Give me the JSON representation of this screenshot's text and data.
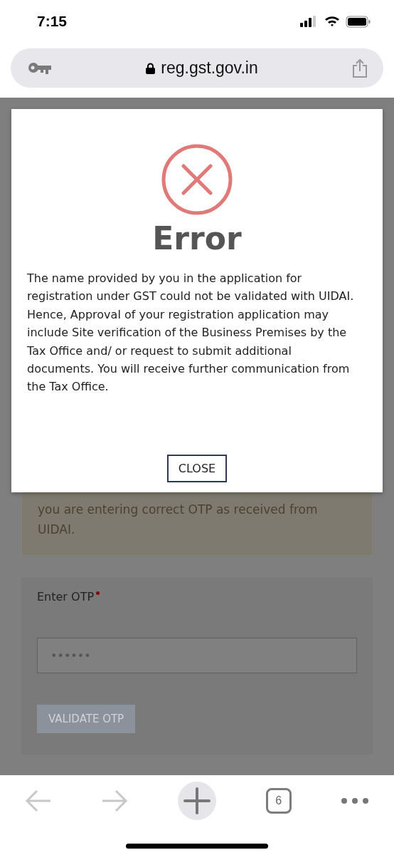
{
  "status_bar": {
    "time": "7:15"
  },
  "address_bar": {
    "url": "reg.gst.gov.in",
    "secure": true
  },
  "notice": {
    "text": "you are entering correct OTP as received from UIDAI."
  },
  "otp_form": {
    "label": "Enter OTP",
    "required": true,
    "value": "••••••",
    "button": {
      "label": "VALIDATE OTP",
      "disabled": true
    }
  },
  "dialog": {
    "title": "Error",
    "message": "The name provided by you in the application for registration under GST could not be validated with UIDAI. Hence, Approval of your registration application may include Site verification of the Business Premises by the Tax Office and/ or request to submit additional documents. You will receive further communication from the Tax Office.",
    "button": "CLOSE"
  },
  "toolbar": {
    "back_disabled": true,
    "forward_disabled": true,
    "tab_count": "6"
  }
}
